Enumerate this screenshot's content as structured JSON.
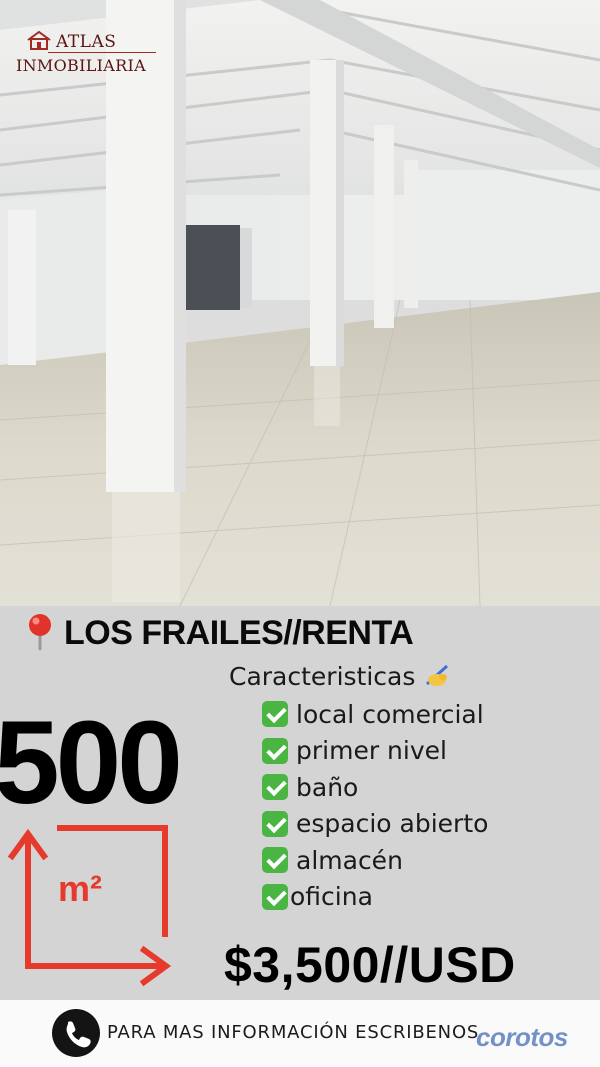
{
  "logo": {
    "line1": "ATLAS",
    "line2": "INMOBILIARIA",
    "color": "#5a1512"
  },
  "listing": {
    "title": "LOS FRAILES//RENTA",
    "pin_icon": "round-pushpin-icon",
    "features_heading": "Caracteristicas",
    "features_heading_icon": "writing-hand-icon",
    "features": [
      "local comercial",
      "primer nivel",
      "baño",
      "espacio abierto",
      "almacén",
      "oficina"
    ],
    "check_icon": "check-mark-button-icon",
    "area_value": "500",
    "area_unit": "m²",
    "price": "$3,500//USD"
  },
  "footer": {
    "cta": "PARA MAS INFORMACIÓN ESCRIBENOS",
    "phone_icon": "phone-icon"
  },
  "watermark": "corotos",
  "colors": {
    "accent_red": "#e63a2c",
    "check_green": "#4bb543",
    "panel_gray": "#d4d4d4"
  }
}
